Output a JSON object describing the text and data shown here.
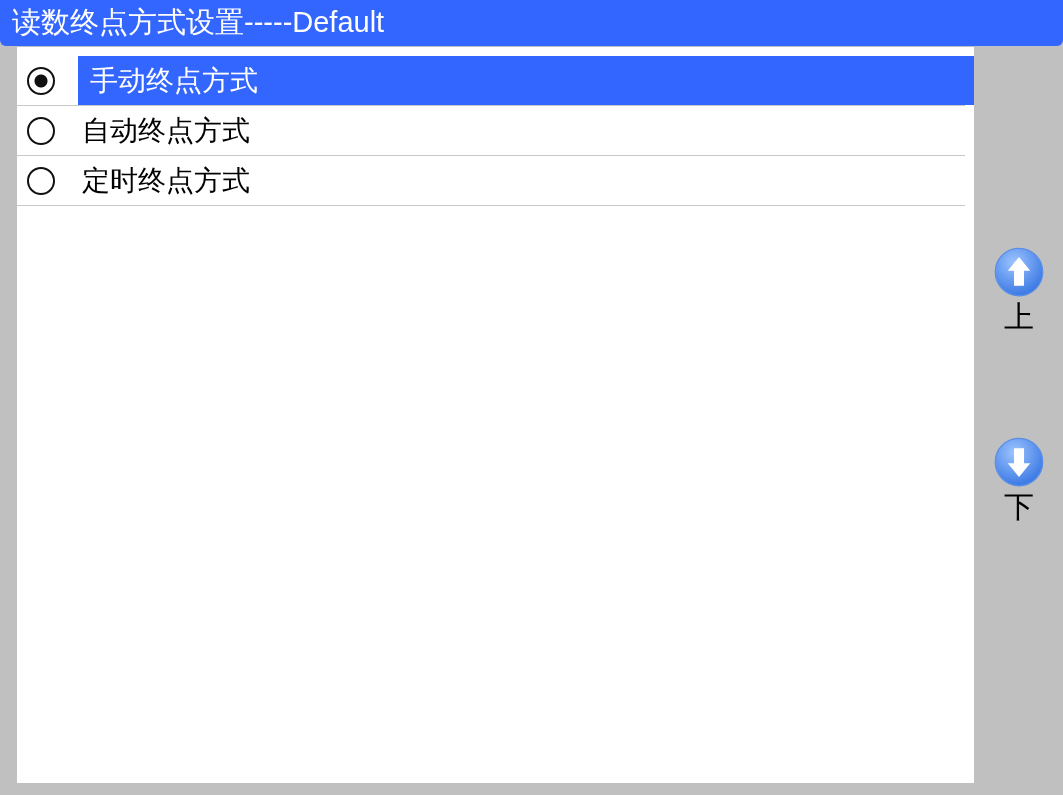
{
  "window": {
    "title": "读数终点方式设置-----Default"
  },
  "options": [
    {
      "label": "手动终点方式",
      "selected": true
    },
    {
      "label": "自动终点方式",
      "selected": false
    },
    {
      "label": "定时终点方式",
      "selected": false
    }
  ],
  "side_buttons": [
    {
      "kind": "up",
      "label": "上"
    },
    {
      "kind": "down",
      "label": "下"
    }
  ]
}
